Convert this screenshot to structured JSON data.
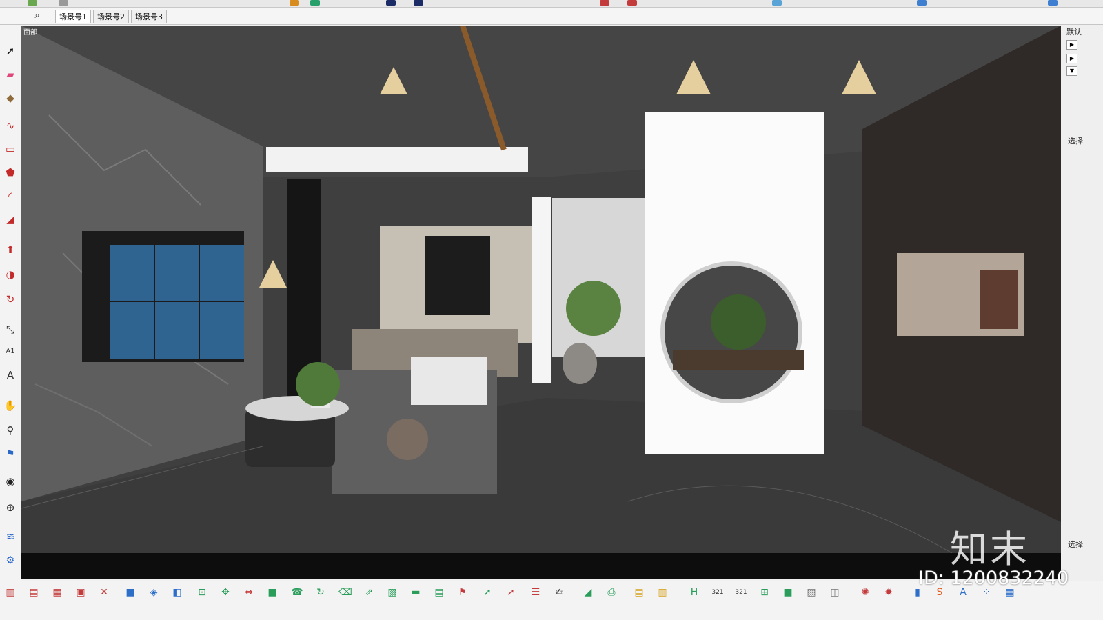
{
  "tabs": {
    "search_icon": "search-icon",
    "scenes": [
      "场景号1",
      "场景号2",
      "场景号3"
    ]
  },
  "viewport": {
    "label": "面部"
  },
  "right_panel": {
    "default_label": "默认",
    "select_label_1": "选择",
    "select_label_2": "选择"
  },
  "watermark": {
    "logo_text": "知末",
    "id_text": "ID: 1200832240"
  },
  "left_tools": [
    "select-icon",
    "eraser-icon",
    "paint-icon",
    "freehand-icon",
    "rectangle-icon",
    "polygon-icon",
    "arc-icon",
    "shape-icon",
    "push-pull-icon",
    "follow-me-icon",
    "rotate-icon",
    "tape-icon",
    "text-icon",
    "dimension-icon",
    "pan-icon",
    "zoom-icon",
    "walk-icon",
    "look-icon",
    "position-camera-icon",
    "sandbox-icon",
    "section-icon"
  ],
  "bottom_tools": [
    "wall-icon",
    "window-icon",
    "grid-icon",
    "frame-icon",
    "axis-icon",
    "box-icon",
    "cube-icon",
    "plane-icon",
    "move-icon",
    "arrows-icon",
    "scale-icon",
    "green-box-icon",
    "phone-icon",
    "cycle-icon",
    "trash-icon",
    "export-icon",
    "stripe-icon",
    "bar-icon",
    "component-icon",
    "flag-icon",
    "cursor-icon",
    "cursor-red-icon",
    "report-icon",
    "hand-icon",
    "chart-icon",
    "stamp-icon",
    "layer-icon",
    "layer2-icon",
    "h-icon",
    "number-icon",
    "number2-icon",
    "axis2-icon",
    "green-block-icon",
    "stack-icon",
    "cube3-icon",
    "gear-icon",
    "gear2-icon",
    "red-s-icon",
    "font-icon",
    "grid2-icon",
    "han-icon",
    "bar2-icon"
  ]
}
